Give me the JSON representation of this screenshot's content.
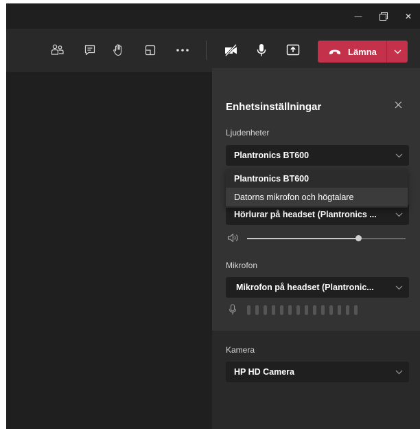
{
  "titlebar": {
    "minimize_glyph": "—",
    "close_glyph": "✕"
  },
  "toolbar": {
    "icons": [
      "people-icon",
      "chat-icon",
      "raise-hand-icon",
      "share-tray-icon",
      "more-icon",
      "camera-off-icon",
      "mic-icon",
      "share-screen-icon"
    ],
    "leave_label": "Lämna",
    "leave_color": "#c4314b"
  },
  "device_settings": {
    "title": "Enhetsinställningar",
    "audio_devices": {
      "label": "Ljudenheter",
      "selected": "Plantronics BT600",
      "options": [
        "Plantronics BT600",
        "Datorns mikrofon och högtalare"
      ],
      "hovered_option": "Datorns mikrofon och högtalare"
    },
    "speaker": {
      "selected": "Hörlurar på headset (Plantronics ...",
      "volume_fraction": 0.7
    },
    "microphone": {
      "label": "Mikrofon",
      "selected": "Mikrofon på headset (Plantronic...",
      "level_bars": 14
    },
    "camera": {
      "label": "Kamera",
      "selected": "HP HD Camera"
    }
  },
  "colors": {
    "background": "#292929",
    "stage": "#1f1f1f",
    "panel_shade": "#333333",
    "dropdown": "#1f1f1f",
    "text": "#ffffff"
  }
}
